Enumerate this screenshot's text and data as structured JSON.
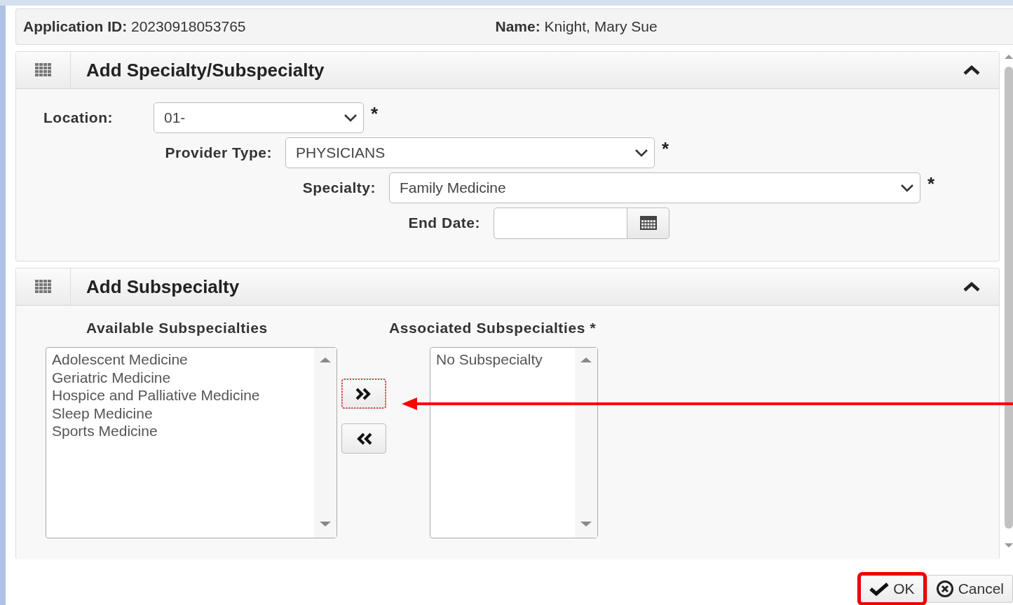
{
  "header": {
    "application_id_label": "Application ID:",
    "application_id": "20230918053765",
    "name_label": "Name:",
    "name": "Knight, Mary Sue"
  },
  "specialty_panel": {
    "title": "Add Specialty/Subspecialty",
    "expanded": true,
    "fields": [
      {
        "kind": "select",
        "label": "Location:",
        "value": "01-",
        "required_mark": "*"
      },
      {
        "kind": "select",
        "label": "Provider Type:",
        "value": "PHYSICIANS",
        "required_mark": "*"
      },
      {
        "kind": "select",
        "label": "Specialty:",
        "value": "Family Medicine",
        "required_mark": "*"
      },
      {
        "kind": "date",
        "label": "End Date:"
      }
    ]
  },
  "subspecialty_panel": {
    "title": "Add Subspecialty",
    "expanded": true,
    "available": {
      "heading": "Available Subspecialties",
      "items": [
        "Adolescent Medicine",
        "Geriatric Medicine",
        "Hospice and Palliative Medicine",
        "Sleep Medicine",
        "Sports Medicine"
      ]
    },
    "move_buttons": [
      {
        "kind": "add",
        "focused": true
      },
      {
        "kind": "remove",
        "focused": false
      }
    ],
    "associated": {
      "heading": "Associated Subspecialties",
      "required_mark": "*",
      "items": [
        "No Subspecialty"
      ]
    }
  },
  "buttons": [
    {
      "kind": "ok",
      "label": "OK",
      "highlighted": true
    },
    {
      "kind": "cancel",
      "label": "Cancel",
      "highlighted": false
    }
  ]
}
